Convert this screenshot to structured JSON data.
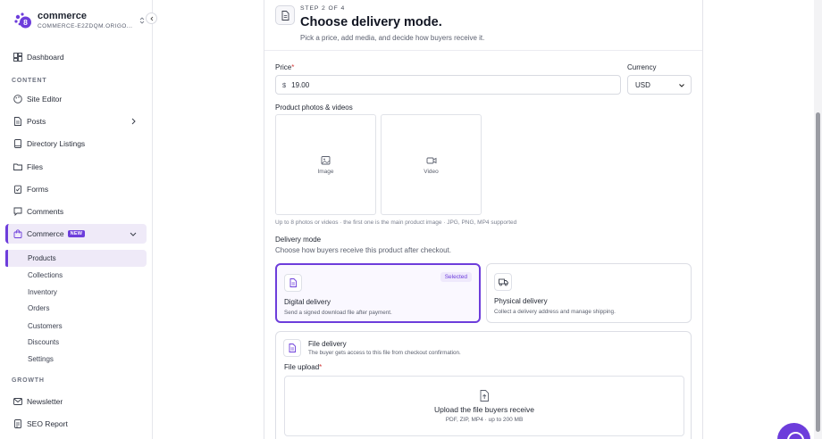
{
  "sidebar": {
    "brand": {
      "name": "commerce",
      "subdomain": "COMMERCE-E2ZDQM.ORIGO..."
    },
    "items": [
      {
        "label": "Dashboard",
        "icon": "dashboard-icon"
      },
      {
        "label": "Site Editor",
        "icon": "palette-icon"
      },
      {
        "label": "Posts",
        "icon": "document-icon"
      },
      {
        "label": "Directory Listings",
        "icon": "book-icon"
      },
      {
        "label": "Files",
        "icon": "folder-icon"
      },
      {
        "label": "Forms",
        "icon": "clipboard-icon"
      },
      {
        "label": "Comments",
        "icon": "comment-icon"
      },
      {
        "label": "Commerce",
        "icon": "bag-icon",
        "badge": "NEW"
      },
      {
        "label": "Newsletter",
        "icon": "mail-icon"
      },
      {
        "label": "SEO Report",
        "icon": "report-icon"
      }
    ],
    "sections": {
      "content": "CONTENT",
      "growth": "GROWTH"
    },
    "commerce_sub": [
      "Products",
      "Collections",
      "Inventory",
      "Orders",
      "Customers",
      "Discounts",
      "Settings"
    ]
  },
  "header": {
    "step": "STEP 2 OF 4",
    "title": "Choose delivery mode.",
    "subtitle": "Pick a price, add media, and decide how buyers receive it."
  },
  "form": {
    "price_label": "Price",
    "price_symbol": "$",
    "price_value": "19.00",
    "currency_label": "Currency",
    "currency_value": "USD",
    "media_label": "Product photos & videos",
    "media_image": "Image",
    "media_video": "Video",
    "media_hint": "Up to 8 photos or videos · the first one is the main product image · JPG, PNG, MP4 supported",
    "delivery_label": "Delivery mode",
    "delivery_desc": "Choose how buyers receive this product after checkout.",
    "options": [
      {
        "title": "Digital delivery",
        "desc": "Send a signed download file after payment.",
        "badge": "Selected"
      },
      {
        "title": "Physical delivery",
        "desc": "Collect a delivery address and manage shipping."
      }
    ],
    "file": {
      "title": "File delivery",
      "desc": "The buyer gets access to this file from checkout confirmation.",
      "upload_label": "File upload",
      "dz_title": "Upload the file buyers receive",
      "dz_sub": "PDF, ZIP, MP4 · up to 200 MB"
    }
  },
  "colors": {
    "accent": "#6d3ddb",
    "required": "#d23b3b"
  }
}
